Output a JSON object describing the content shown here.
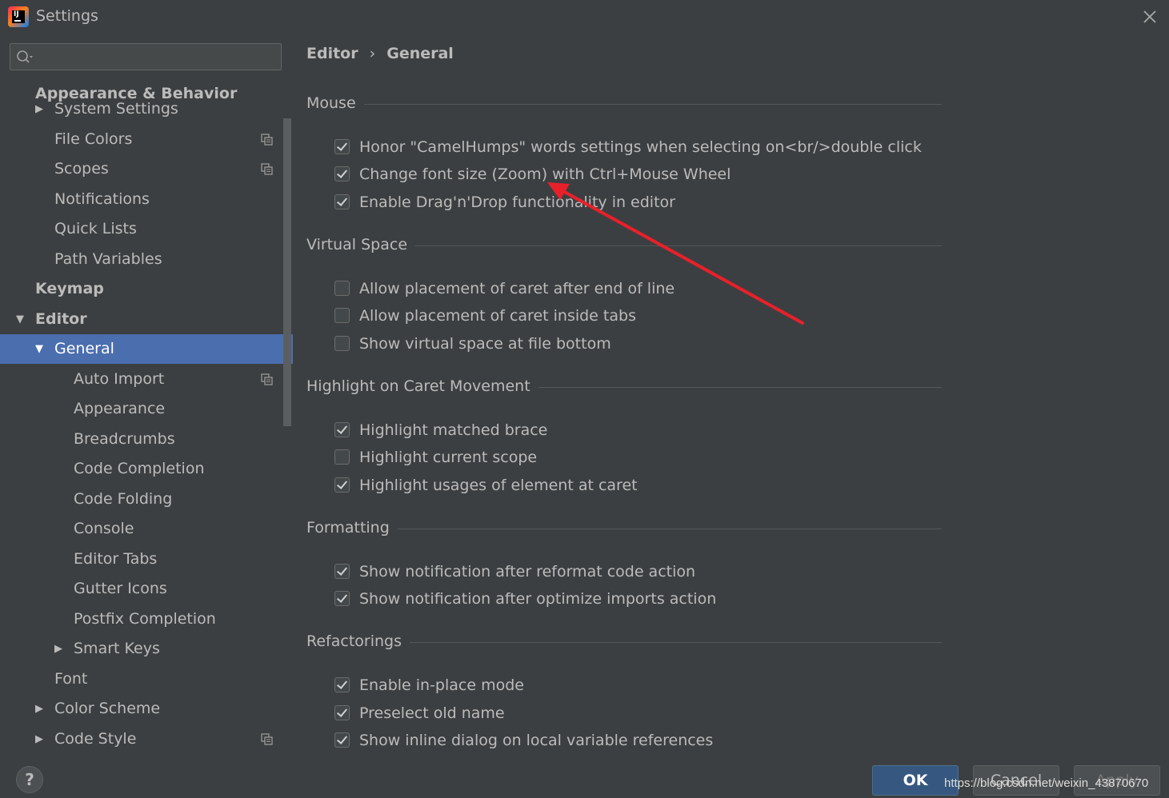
{
  "window": {
    "title": "Settings",
    "colors": {
      "background": "#3c3f41",
      "selection": "#4b6eaf",
      "text": "#bbbbbb",
      "arrow": "#e8202a"
    }
  },
  "search": {
    "value": "",
    "placeholder": ""
  },
  "sidebar": {
    "items": [
      {
        "label": "Appearance & Behavior",
        "bold": true,
        "indent": 0,
        "arrow": "none"
      },
      {
        "label": "System Settings",
        "indent": 1,
        "arrow": "collapsed"
      },
      {
        "label": "File Colors",
        "indent": 1,
        "arrow": "none",
        "copy_icon": true
      },
      {
        "label": "Scopes",
        "indent": 1,
        "arrow": "none",
        "copy_icon": true
      },
      {
        "label": "Notifications",
        "indent": 1,
        "arrow": "none"
      },
      {
        "label": "Quick Lists",
        "indent": 1,
        "arrow": "none"
      },
      {
        "label": "Path Variables",
        "indent": 1,
        "arrow": "none"
      },
      {
        "label": "Keymap",
        "bold": true,
        "indent": 0,
        "arrow": "none"
      },
      {
        "label": "Editor",
        "bold": true,
        "indent": 0,
        "arrow": "expanded"
      },
      {
        "label": "General",
        "indent": 1,
        "arrow": "expanded",
        "selected": true
      },
      {
        "label": "Auto Import",
        "indent": 2,
        "arrow": "none",
        "copy_icon": true
      },
      {
        "label": "Appearance",
        "indent": 2,
        "arrow": "none"
      },
      {
        "label": "Breadcrumbs",
        "indent": 2,
        "arrow": "none"
      },
      {
        "label": "Code Completion",
        "indent": 2,
        "arrow": "none"
      },
      {
        "label": "Code Folding",
        "indent": 2,
        "arrow": "none"
      },
      {
        "label": "Console",
        "indent": 2,
        "arrow": "none"
      },
      {
        "label": "Editor Tabs",
        "indent": 2,
        "arrow": "none"
      },
      {
        "label": "Gutter Icons",
        "indent": 2,
        "arrow": "none"
      },
      {
        "label": "Postfix Completion",
        "indent": 2,
        "arrow": "none"
      },
      {
        "label": "Smart Keys",
        "indent": 2,
        "arrow": "collapsed"
      },
      {
        "label": "Font",
        "indent": 1,
        "arrow": "none"
      },
      {
        "label": "Color Scheme",
        "indent": 1,
        "arrow": "collapsed"
      },
      {
        "label": "Code Style",
        "indent": 1,
        "arrow": "collapsed",
        "copy_icon": true
      }
    ]
  },
  "breadcrumb": {
    "parent": "Editor",
    "separator": "›",
    "current": "General"
  },
  "sections": [
    {
      "title": "Mouse",
      "options": [
        {
          "label": "Honor \"CamelHumps\" words settings when selecting on<br/>double click",
          "checked": true
        },
        {
          "label": "Change font size (Zoom) with Ctrl+Mouse Wheel",
          "checked": true
        },
        {
          "label": "Enable Drag'n'Drop functionality in editor",
          "checked": true
        }
      ]
    },
    {
      "title": "Virtual Space",
      "options": [
        {
          "label": "Allow placement of caret after end of line",
          "checked": false
        },
        {
          "label": "Allow placement of caret inside tabs",
          "checked": false
        },
        {
          "label": "Show virtual space at file bottom",
          "checked": false
        }
      ]
    },
    {
      "title": "Highlight on Caret Movement",
      "options": [
        {
          "label": "Highlight matched brace",
          "checked": true
        },
        {
          "label": "Highlight current scope",
          "checked": false
        },
        {
          "label": "Highlight usages of element at caret",
          "checked": true
        }
      ]
    },
    {
      "title": "Formatting",
      "options": [
        {
          "label": "Show notification after reformat code action",
          "checked": true
        },
        {
          "label": "Show notification after optimize imports action",
          "checked": true
        }
      ]
    },
    {
      "title": "Refactorings",
      "options": [
        {
          "label": "Enable in-place mode",
          "checked": true
        },
        {
          "label": "Preselect old name",
          "checked": true
        },
        {
          "label": "Show inline dialog on local variable references",
          "checked": true
        }
      ]
    }
  ],
  "footer": {
    "help_label": "?",
    "ok_label": "OK",
    "cancel_label": "Cancel",
    "apply_label": "Apply",
    "watermark": "https://blog.csdn.net/weixin_43870670"
  }
}
